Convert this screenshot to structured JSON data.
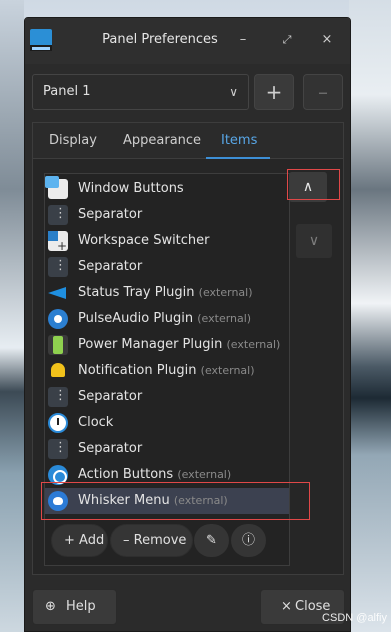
{
  "window": {
    "title": "Panel Preferences"
  },
  "titlebar_buttons": {
    "minimize": "–",
    "maximize": "⤢",
    "close": "×"
  },
  "panel_select": {
    "value": "Panel 1"
  },
  "panel_buttons": {
    "add": "+",
    "remove": "–"
  },
  "tabs": [
    {
      "label": "Display"
    },
    {
      "label": "Appearance"
    },
    {
      "label": "Items"
    }
  ],
  "items": [
    {
      "label": "Window Buttons",
      "ext": ""
    },
    {
      "label": "Separator",
      "ext": ""
    },
    {
      "label": "Workspace Switcher",
      "ext": ""
    },
    {
      "label": "Separator",
      "ext": ""
    },
    {
      "label": "Status Tray Plugin",
      "ext": "(external)"
    },
    {
      "label": "PulseAudio Plugin",
      "ext": "(external)"
    },
    {
      "label": "Power Manager Plugin",
      "ext": "(external)"
    },
    {
      "label": "Notification Plugin",
      "ext": "(external)"
    },
    {
      "label": "Separator",
      "ext": ""
    },
    {
      "label": "Clock",
      "ext": ""
    },
    {
      "label": "Separator",
      "ext": ""
    },
    {
      "label": "Action Buttons",
      "ext": "(external)"
    },
    {
      "label": "Whisker Menu",
      "ext": "(external)"
    }
  ],
  "list_buttons": {
    "add": "Add",
    "remove": "Remove"
  },
  "footer": {
    "help": "Help",
    "close": "Close"
  },
  "watermark": "CSDN @alfiy",
  "colors": {
    "accent": "#3d8fd6",
    "highlight": "#e04848",
    "selected_row": "#3c4150"
  }
}
